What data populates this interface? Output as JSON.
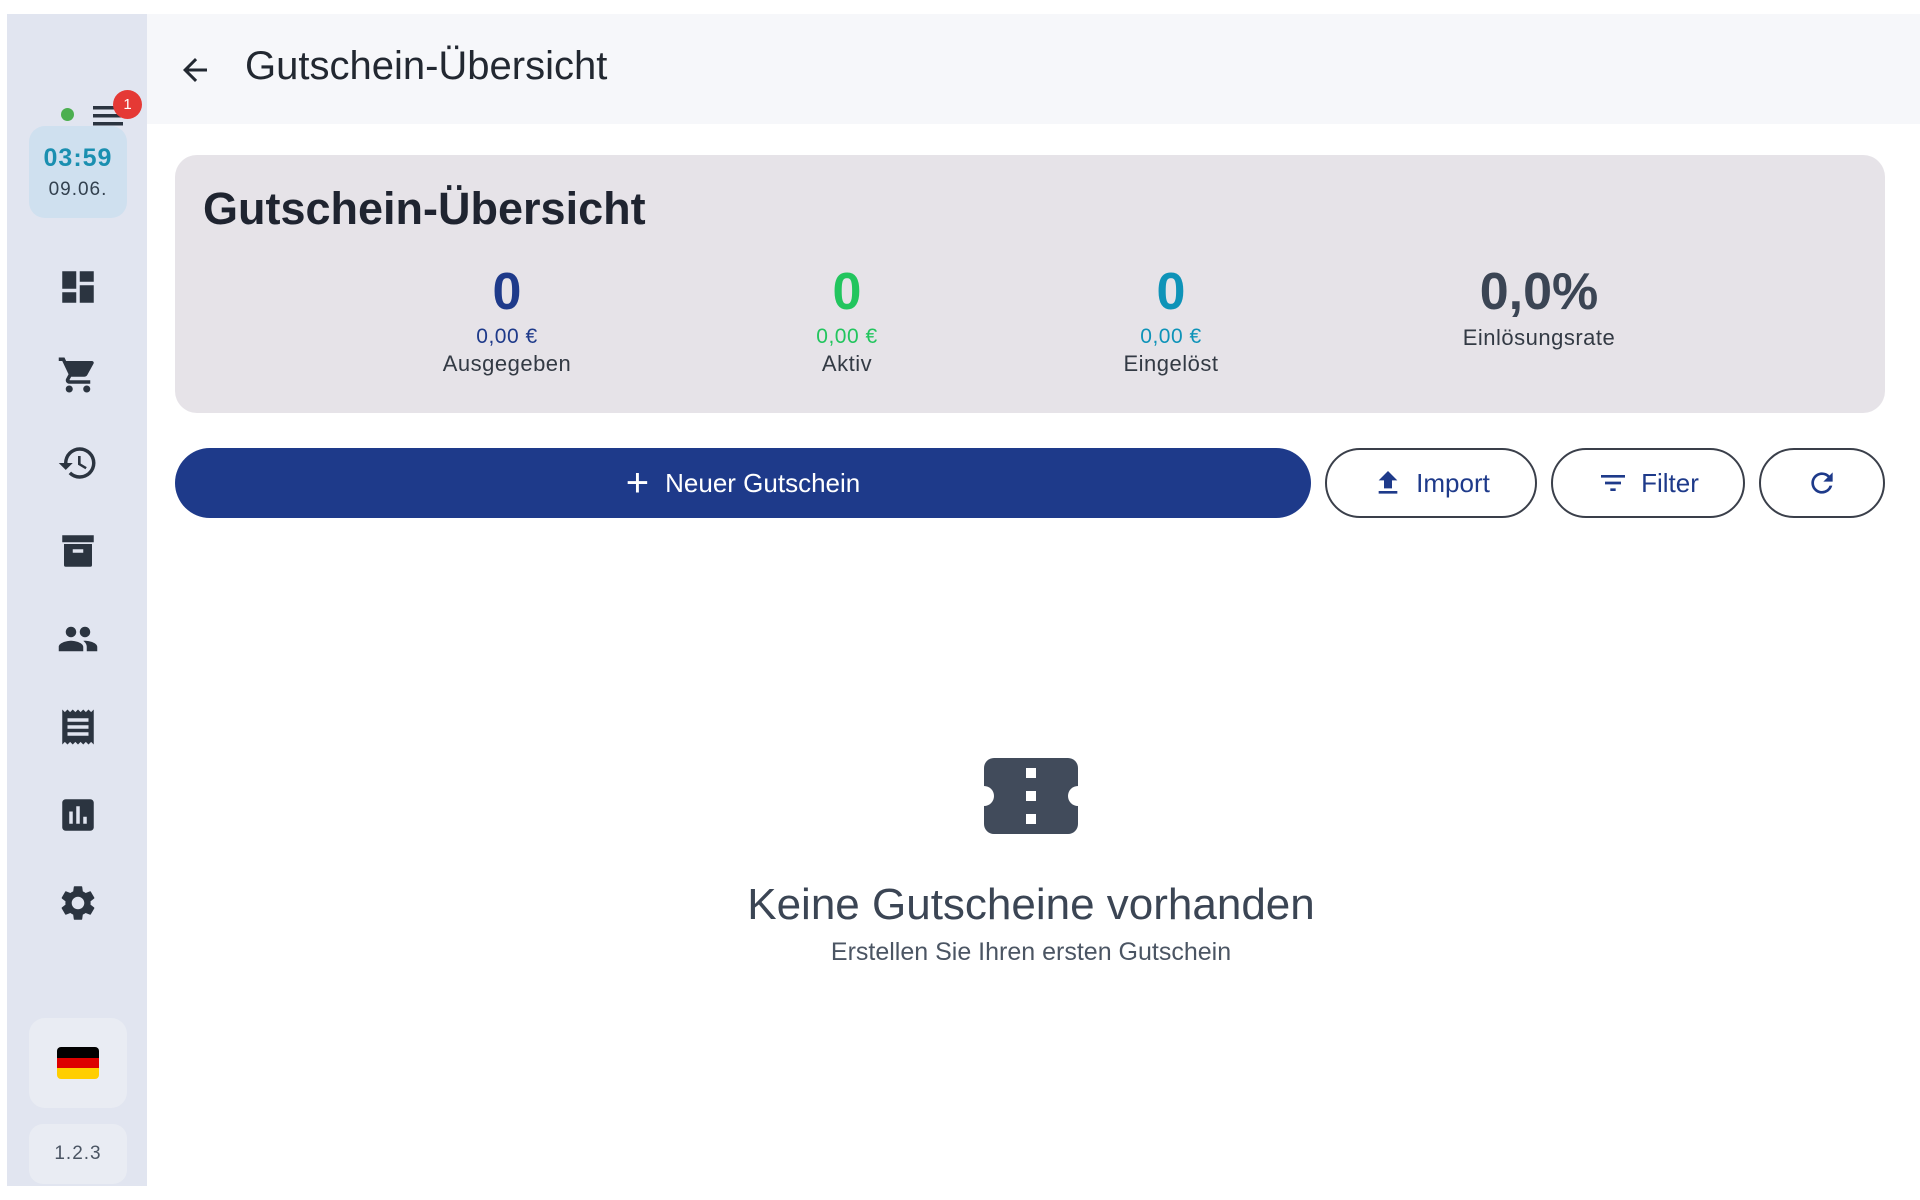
{
  "sidebar": {
    "badge_count": "1",
    "status_color": "#4caf50",
    "clock": {
      "time": "03:59",
      "date": "09.06."
    },
    "nav_items": [
      {
        "name": "dashboard-icon"
      },
      {
        "name": "cart-icon"
      },
      {
        "name": "history-icon"
      },
      {
        "name": "archive-icon"
      },
      {
        "name": "people-icon"
      },
      {
        "name": "receipt-icon"
      },
      {
        "name": "chart-icon"
      },
      {
        "name": "gear-icon"
      }
    ],
    "language_flag": "germany-flag",
    "version": "1.2.3"
  },
  "header": {
    "title": "Gutschein-Übersicht"
  },
  "summary": {
    "title": "Gutschein-Übersicht",
    "stats": [
      {
        "count": "0",
        "amount": "0,00 €",
        "label": "Ausgegeben",
        "color": "#1e3a8a"
      },
      {
        "count": "0",
        "amount": "0,00 €",
        "label": "Aktiv",
        "color": "#22c55e"
      },
      {
        "count": "0",
        "amount": "0,00 €",
        "label": "Eingelöst",
        "color": "#0e93b8"
      },
      {
        "count": "0,0%",
        "label": "Einlösungsrate",
        "color": "#3b4554"
      }
    ]
  },
  "actions": {
    "new_voucher": "Neuer Gutschein",
    "import": "Import",
    "filter": "Filter",
    "accent_color": "#1e3a8a"
  },
  "empty_state": {
    "icon": "ticket-icon",
    "title": "Keine Gutscheine vorhanden",
    "subtitle": "Erstellen Sie Ihren ersten Gutschein"
  }
}
